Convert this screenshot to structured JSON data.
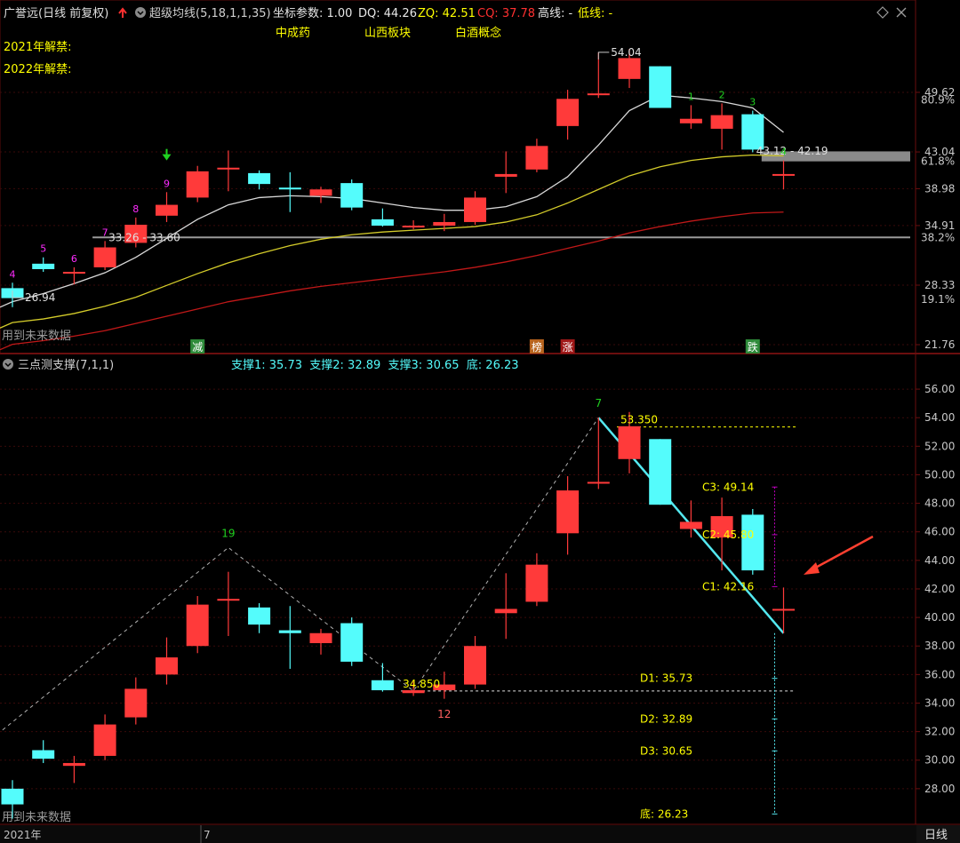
{
  "header": {
    "stock": "广誉远(日线 前复权)",
    "indicator": "超级均线(5,18,1,1,35)",
    "coord_label": "坐标参数: 1.00",
    "dq": "DQ: 44.26",
    "zq": "ZQ: 42.51",
    "cq": "CQ: 37.78",
    "high": "高线: -",
    "low": "低线: -"
  },
  "tags": [
    "中成药",
    "山西板块",
    "白酒概念"
  ],
  "unlock": [
    "2021年解禁:",
    "2022年解禁:"
  ],
  "future_note": "用到未来数据",
  "events": [
    {
      "text": "减",
      "bar": 6,
      "color": "#2e8b3a"
    },
    {
      "text": "榜",
      "bar": 17,
      "color": "#b8641e"
    },
    {
      "text": "涨",
      "bar": 18,
      "color": "#a01818"
    },
    {
      "text": "跌",
      "bar": 24,
      "color": "#2e8b3a"
    }
  ],
  "lower_header": {
    "name": "三点测支撑(7,1,1)",
    "values": "支撑1: 35.73  支撑2: 32.89  支撑3: 30.65  底: 26.23"
  },
  "footer": {
    "year": "2021年",
    "month": "7",
    "period": "日线"
  },
  "colors": {
    "up": "#ff3a3a",
    "down": "#54fcfc",
    "ma_white": "#d8d8d8",
    "ma_yellow": "#d4cc2a",
    "ma_red": "#c01818",
    "grid": "#3a0a0a",
    "label_yellow": "#ffff00"
  },
  "chart_data": [
    {
      "type": "candlestick",
      "name": "main",
      "ylim": [
        21.76,
        55.5
      ],
      "y_ticks": [
        "49.62",
        "43.04",
        "38.98",
        "34.91",
        "28.33",
        "21.76"
      ],
      "pct_ticks": [
        {
          "label": "80.9%",
          "value": 48.8
        },
        {
          "label": "61.8%",
          "value": 42.0
        },
        {
          "label": "38.2%",
          "value": 33.6
        },
        {
          "label": "19.1%",
          "value": 26.75
        }
      ],
      "candles": [
        {
          "o": 28.0,
          "h": 28.6,
          "l": 25.9,
          "c": 26.9
        },
        {
          "o": 30.7,
          "h": 31.4,
          "l": 29.8,
          "c": 30.1
        },
        {
          "o": 29.6,
          "h": 30.3,
          "l": 28.4,
          "c": 29.8
        },
        {
          "o": 30.3,
          "h": 33.2,
          "l": 30.0,
          "c": 32.5
        },
        {
          "o": 33.0,
          "h": 35.8,
          "l": 32.5,
          "c": 35.0
        },
        {
          "o": 36.0,
          "h": 38.6,
          "l": 35.3,
          "c": 37.2
        },
        {
          "o": 38.0,
          "h": 41.5,
          "l": 37.5,
          "c": 40.9
        },
        {
          "o": 41.3,
          "h": 43.2,
          "l": 38.7,
          "c": 41.3
        },
        {
          "o": 40.7,
          "h": 41.0,
          "l": 38.9,
          "c": 39.5
        },
        {
          "o": 39.1,
          "h": 40.8,
          "l": 36.4,
          "c": 38.9
        },
        {
          "o": 38.2,
          "h": 39.2,
          "l": 37.4,
          "c": 38.9
        },
        {
          "o": 39.6,
          "h": 40.0,
          "l": 36.6,
          "c": 36.9
        },
        {
          "o": 35.6,
          "h": 36.8,
          "l": 34.8,
          "c": 34.9
        },
        {
          "o": 34.7,
          "h": 35.5,
          "l": 34.5,
          "c": 34.9
        },
        {
          "o": 34.9,
          "h": 36.2,
          "l": 34.3,
          "c": 35.3
        },
        {
          "o": 35.3,
          "h": 38.7,
          "l": 35.0,
          "c": 38.0
        },
        {
          "o": 40.3,
          "h": 43.1,
          "l": 38.5,
          "c": 40.6
        },
        {
          "o": 41.1,
          "h": 44.5,
          "l": 40.8,
          "c": 43.7
        },
        {
          "o": 45.9,
          "h": 49.9,
          "l": 44.4,
          "c": 48.9
        },
        {
          "o": 49.5,
          "h": 54.0,
          "l": 49.0,
          "c": 49.5
        },
        {
          "o": 51.1,
          "h": 54.4,
          "l": 50.1,
          "c": 53.4
        },
        {
          "o": 52.5,
          "h": 52.5,
          "l": 47.9,
          "c": 47.9
        },
        {
          "o": 46.2,
          "h": 48.2,
          "l": 45.6,
          "c": 46.7
        },
        {
          "o": 45.6,
          "h": 48.4,
          "l": 43.3,
          "c": 47.1
        },
        {
          "o": 47.2,
          "h": 47.6,
          "l": 43.0,
          "c": 43.3
        },
        {
          "o": 40.6,
          "h": 42.1,
          "l": 38.9,
          "c": 40.6
        }
      ],
      "ma_white": [
        26.5,
        27.4,
        28.5,
        29.7,
        31.4,
        33.5,
        35.6,
        37.2,
        38.0,
        38.2,
        38.1,
        37.9,
        37.4,
        36.9,
        36.6,
        36.6,
        37.0,
        38.1,
        40.3,
        43.8,
        47.6,
        49.3,
        49.0,
        48.6,
        47.9,
        45.2
      ],
      "ma_yellow": [
        24.2,
        24.6,
        25.2,
        26.0,
        27.0,
        28.3,
        29.6,
        30.8,
        31.8,
        32.7,
        33.4,
        33.9,
        34.2,
        34.4,
        34.6,
        34.8,
        35.3,
        36.1,
        37.4,
        38.9,
        40.4,
        41.4,
        42.1,
        42.5,
        42.7,
        42.6
      ],
      "ma_red": [
        21.8,
        22.2,
        22.7,
        23.3,
        24.1,
        24.9,
        25.7,
        26.5,
        27.1,
        27.7,
        28.2,
        28.6,
        29.0,
        29.4,
        29.8,
        30.3,
        30.9,
        31.6,
        32.4,
        33.2,
        34.1,
        34.8,
        35.4,
        35.9,
        36.3,
        36.4
      ],
      "hlines": [
        {
          "value": 33.6
        },
        {
          "value": 42.2
        }
      ],
      "annotations": [
        {
          "text": "26.94",
          "bar": 0,
          "value": 26.94
        },
        {
          "text": "33.26 - 33.60",
          "bar": 3,
          "value": 33.6
        },
        {
          "text": "54.04",
          "bar": 19,
          "value": 54.04
        },
        {
          "text": "43.12 - 42.19",
          "bar": 24,
          "value": 43.12
        }
      ],
      "count_labels": [
        {
          "text": "4",
          "bar": 0,
          "color": "#ff2cff"
        },
        {
          "text": "5",
          "bar": 1,
          "color": "#ff2cff"
        },
        {
          "text": "6",
          "bar": 2,
          "color": "#ff2cff"
        },
        {
          "text": "7",
          "bar": 3,
          "color": "#ff2cff"
        },
        {
          "text": "8",
          "bar": 4,
          "color": "#ff2cff"
        },
        {
          "text": "9",
          "bar": 5,
          "color": "#ff2cff"
        },
        {
          "text": "1",
          "bar": 22,
          "color": "#20d020"
        },
        {
          "text": "2",
          "bar": 23,
          "color": "#20d020"
        },
        {
          "text": "3",
          "bar": 24,
          "color": "#20d020"
        },
        {
          "text": "4",
          "bar": 25,
          "color": "#20d020"
        }
      ]
    },
    {
      "type": "candlestick",
      "name": "lower",
      "ylim": [
        26.0,
        57.0
      ],
      "y_ticks": [
        56,
        54,
        52,
        50,
        48,
        46,
        44,
        42,
        40,
        38,
        36,
        34,
        32,
        30,
        28
      ],
      "candles_same_as_main": true,
      "zigzag": [
        {
          "bar": -0.5,
          "value": 31.8
        },
        {
          "bar": 7,
          "value": 44.9
        },
        {
          "bar": 13,
          "value": 34.85
        },
        {
          "bar": 19,
          "value": 54.0
        }
      ],
      "zigzag_labels": [
        {
          "text": "19",
          "bar": 7,
          "value": 44.9,
          "color": "#20d020"
        },
        {
          "text": "12",
          "bar": 14,
          "value": 34.85,
          "color": "#ff6060"
        },
        {
          "text": "7",
          "bar": 19,
          "value": 54.0,
          "color": "#20d020"
        }
      ],
      "trend": [
        {
          "bar": 19,
          "value": 54.0
        },
        {
          "bar": 25,
          "value": 38.9
        }
      ],
      "levels": [
        {
          "text": "53.350",
          "value": 53.35,
          "from_bar": 20
        },
        {
          "text": "34.850",
          "value": 34.85,
          "from_bar": 13
        }
      ],
      "c_levels": [
        {
          "text": "C3: 49.14",
          "value": 49.14
        },
        {
          "text": "C2: 45.80",
          "value": 45.8
        },
        {
          "text": "C1: 42.16",
          "value": 42.16
        }
      ],
      "d_levels": [
        {
          "text": "D1: 35.73",
          "value": 35.73
        },
        {
          "text": "D2: 32.89",
          "value": 32.89
        },
        {
          "text": "D3: 30.65",
          "value": 30.65
        },
        {
          "text": "底: 26.23",
          "value": 26.23
        }
      ]
    }
  ]
}
